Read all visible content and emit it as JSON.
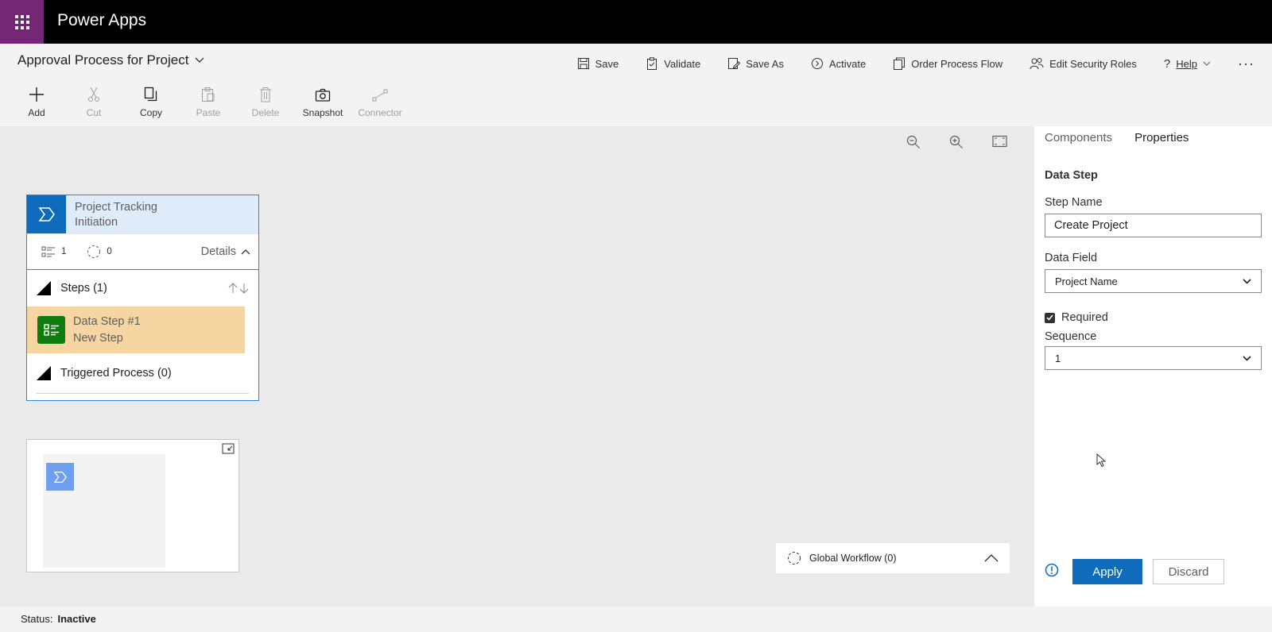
{
  "header": {
    "app_name": "Power Apps",
    "waffle_icon": "waffle-icon"
  },
  "process": {
    "title": "Approval Process for Project"
  },
  "top_actions": [
    {
      "label": "Save",
      "icon": "save-icon"
    },
    {
      "label": "Validate",
      "icon": "validate-icon"
    },
    {
      "label": "Save As",
      "icon": "save-as-icon"
    },
    {
      "label": "Activate",
      "icon": "activate-icon"
    },
    {
      "label": "Order Process Flow",
      "icon": "order-flow-icon"
    },
    {
      "label": "Edit Security Roles",
      "icon": "security-roles-icon"
    },
    {
      "label": "Help",
      "icon": "help-icon"
    }
  ],
  "ribbon": [
    {
      "label": "Add",
      "enabled": true
    },
    {
      "label": "Cut",
      "enabled": false
    },
    {
      "label": "Copy",
      "enabled": true
    },
    {
      "label": "Paste",
      "enabled": false
    },
    {
      "label": "Delete",
      "enabled": false
    },
    {
      "label": "Snapshot",
      "enabled": true
    },
    {
      "label": "Connector",
      "enabled": false
    }
  ],
  "stage": {
    "title_line1": "Project Tracking",
    "title_line2": "Initiation",
    "steps_count": "1",
    "workflows_count": "0",
    "details_label": "Details",
    "steps_label": "Steps (1)",
    "step_title": "Data Step #1",
    "step_subtitle": "New Step",
    "triggered_label": "Triggered Process (0)"
  },
  "global_workflow": {
    "label": "Global Workflow (0)"
  },
  "status": {
    "label": "Status:",
    "value": "Inactive"
  },
  "panel": {
    "tabs": [
      {
        "label": "Components"
      },
      {
        "label": "Properties"
      }
    ],
    "section_title": "Data Step",
    "step_name_label": "Step Name",
    "step_name_value": "Create Project",
    "data_field_label": "Data Field",
    "data_field_value": "Project Name",
    "required_label": "Required",
    "sequence_label": "Sequence",
    "sequence_value": "1",
    "apply_label": "Apply",
    "discard_label": "Discard"
  },
  "colors": {
    "brand": "#742774",
    "accent": "#0f6cbd",
    "step_green": "#107c10",
    "selected_step": "#f5d6a3"
  }
}
